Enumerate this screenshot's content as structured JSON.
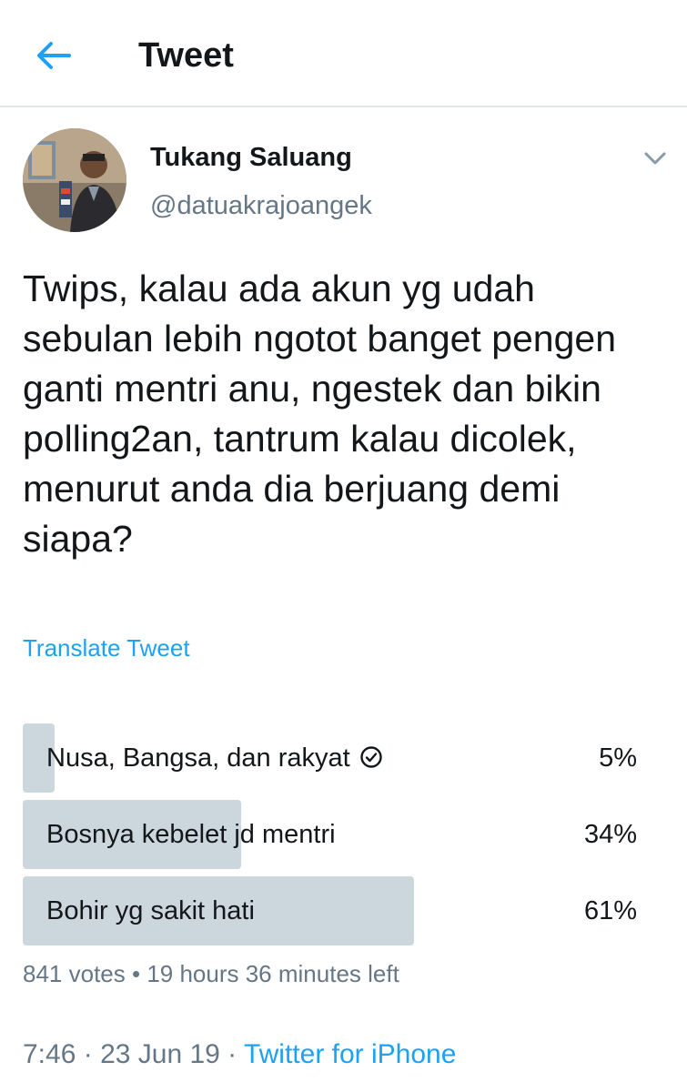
{
  "header": {
    "title": "Tweet",
    "back_icon": "arrow-left-icon"
  },
  "tweet": {
    "author_name": "Tukang Saluang",
    "handle": "@datuakrajoangek",
    "text": "Twips, kalau ada akun yg udah sebulan lebih ngotot banget pengen ganti mentri anu, ngestek dan bikin polling2an, tantrum kalau dicolek, menurut anda dia berjuang demi siapa?",
    "translate_label": "Translate Tweet",
    "poll": {
      "options": [
        {
          "label": "Nusa, Bangsa, dan rakyat",
          "percent": "5%",
          "fraction": 0.05,
          "voted": true
        },
        {
          "label": "Bosnya kebelet jd mentri",
          "percent": "34%",
          "fraction": 0.34,
          "voted": false
        },
        {
          "label": "Bohir yg sakit hati",
          "percent": "61%",
          "fraction": 0.61,
          "voted": false
        }
      ],
      "votes": "841 votes",
      "time_left": "19 hours 36 minutes left",
      "separator": " • "
    },
    "time": "7:46",
    "date": "23 Jun 19",
    "source": "Twitter for iPhone",
    "separator": " · "
  },
  "colors": {
    "accent": "#1da1f2",
    "poll_fill": "#ccd6dd",
    "muted": "#657786",
    "text": "#14171a"
  }
}
